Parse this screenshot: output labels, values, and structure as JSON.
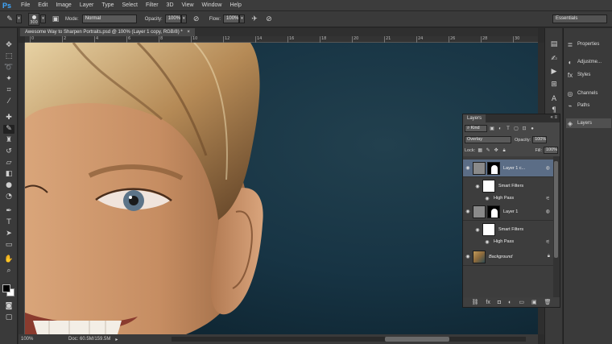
{
  "app": {
    "logo": "Ps"
  },
  "menu": [
    "File",
    "Edit",
    "Image",
    "Layer",
    "Type",
    "Select",
    "Filter",
    "3D",
    "View",
    "Window",
    "Help"
  ],
  "options": {
    "brush_size": "300",
    "mode_label": "Mode:",
    "mode_value": "Normal",
    "opacity_label": "Opacity:",
    "opacity_value": "100%",
    "flow_label": "Flow:",
    "flow_value": "100%",
    "workspace": "Essentials"
  },
  "document": {
    "tab_title": "Awesome Way to Sharpen Portraits.psd @ 100% (Layer 1 copy, RGB/8) *",
    "ruler_marks": [
      "0",
      "2",
      "4",
      "6",
      "8",
      "10",
      "12",
      "14",
      "16",
      "18",
      "20",
      "21",
      "24",
      "26",
      "28",
      "30"
    ],
    "zoom": "100%",
    "doc_size": "Doc: 60.5M/159.5M"
  },
  "dock": {
    "items": [
      "Properties",
      "Adjustme...",
      "Styles",
      "Channels",
      "Paths",
      "Layers"
    ],
    "icons": [
      "properties-icon",
      "adjustments-icon",
      "styles-icon",
      "channels-icon",
      "paths-icon",
      "layers-icon"
    ]
  },
  "layers_panel": {
    "tab": "Layers",
    "kind": "Kind",
    "blend_mode": "Overlay",
    "opacity_label": "Opacity:",
    "opacity_value": "100%",
    "lock_label": "Lock:",
    "fill_label": "Fill:",
    "fill_value": "100%",
    "layers": [
      {
        "name": "Layer 1 c...",
        "selected": true
      },
      {
        "smart_filters": "Smart Filters",
        "filter": "High Pass"
      },
      {
        "name": "Layer 1",
        "selected": false
      },
      {
        "smart_filters": "Smart Filters",
        "filter": "High Pass"
      },
      {
        "name": "Background",
        "locked": true
      }
    ]
  },
  "colors": {
    "background": "#2b2b2b",
    "panel": "#474747",
    "selected_layer": "#5b6d86",
    "ps_blue": "#3fa8ff",
    "canvas_bg": "#163240",
    "skin": "#c9966a",
    "hair": "#b98d55"
  }
}
